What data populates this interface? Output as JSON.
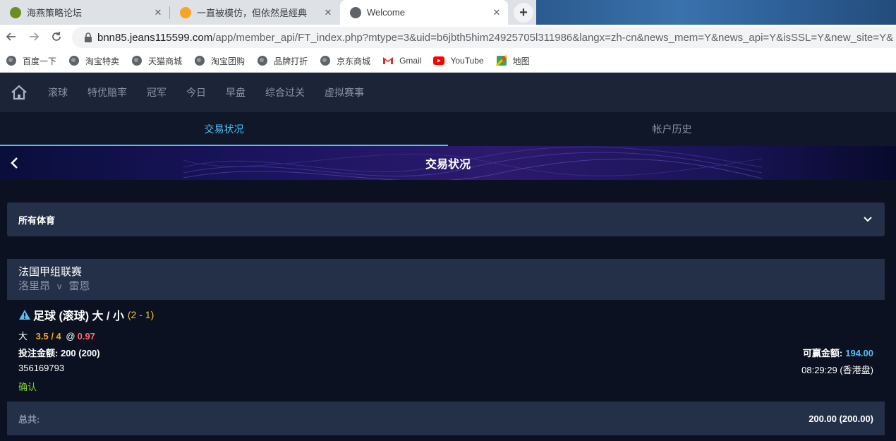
{
  "browser": {
    "tabs": [
      {
        "title": "海燕策略论坛",
        "favicon_color": "#6b8e23"
      },
      {
        "title": "一直被模仿，但依然是經典",
        "favicon_color": "#f5a623"
      },
      {
        "title": "Welcome",
        "favicon_color": "#5f6368"
      }
    ],
    "close_glyph": "✕",
    "new_tab_glyph": "+",
    "url_host": "bnn85.jeans115599.com",
    "url_path": "/app/member_api/FT_index.php?mtype=3&uid=b6jbth5him24925705l311986&langx=zh-cn&news_mem=Y&news_api=Y&isSSL=Y&new_site=Y&"
  },
  "bookmarks": [
    {
      "label": "百度一下",
      "icon": "globe-icon"
    },
    {
      "label": "淘宝特卖",
      "icon": "globe-icon"
    },
    {
      "label": "天猫商城",
      "icon": "globe-icon"
    },
    {
      "label": "淘宝团购",
      "icon": "globe-icon"
    },
    {
      "label": "品牌打折",
      "icon": "globe-icon"
    },
    {
      "label": "京东商城",
      "icon": "globe-icon"
    },
    {
      "label": "Gmail",
      "icon": "gmail-icon"
    },
    {
      "label": "YouTube",
      "icon": "youtube-icon"
    },
    {
      "label": "地图",
      "icon": "maps-icon"
    }
  ],
  "nav": {
    "items": [
      "滚球",
      "特优赔率",
      "冠军",
      "今日",
      "早盘",
      "综合过关",
      "虚拟赛事"
    ]
  },
  "subtabs": {
    "active": "交易状况",
    "other": "帐户历史"
  },
  "header": {
    "title": "交易状况"
  },
  "filter": {
    "label": "所有体育"
  },
  "league": {
    "name": "法国甲组联赛",
    "home": "洛里昂",
    "vs": "v",
    "away": "雷恩"
  },
  "bet": {
    "type": "足球 (滚球) 大 / 小",
    "score": "(2 - 1)",
    "side": "大",
    "line": "3.5 / 4",
    "at": "@",
    "odds": "0.97",
    "stake_label": "投注金额:",
    "stake_value": "200 (200)",
    "ticket_id": "356169793",
    "status": "确认",
    "win_label": "可赢金额:",
    "win_value": "194.00",
    "time": "08:29:29 (香港盘)"
  },
  "total": {
    "label": "总共:",
    "value": "200.00 (200.00)"
  },
  "colors": {
    "accent": "#4fc3f7",
    "odds": "#ff6b6b",
    "line": "#f5a623",
    "confirm": "#7ed321",
    "score": "#f4c430"
  }
}
